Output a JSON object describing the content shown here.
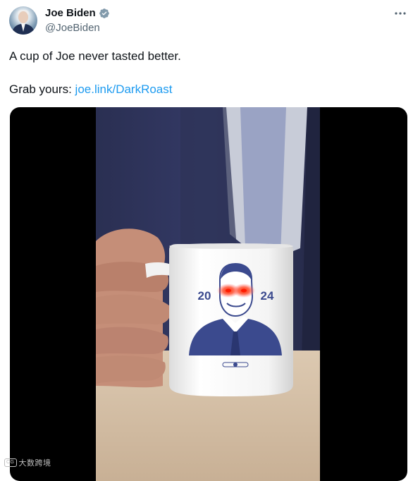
{
  "tweet": {
    "author": {
      "display_name": "Joe Biden",
      "handle": "@JoeBiden",
      "verified_icon": "verified-badge-icon",
      "avatar": "avatar"
    },
    "text_line1": "A cup of Joe never tasted better.",
    "text_line2_prefix": "Grab yours: ",
    "link_text": "joe.link/DarkRoast",
    "more_icon": "more-horizontal-icon",
    "colors": {
      "link": "#1d9bf0",
      "verified": "#1d9bf0",
      "mug_print": "#3b4a8e"
    }
  },
  "media": {
    "mug": {
      "year_left": "20",
      "year_right": "24"
    }
  },
  "watermark": {
    "badge": "CG",
    "text": "大数跨境"
  }
}
